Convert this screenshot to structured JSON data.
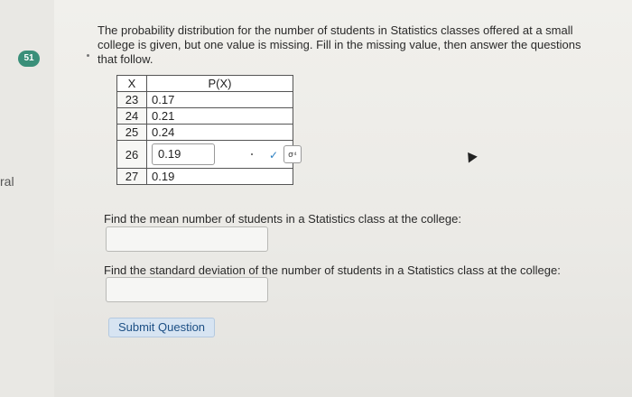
{
  "question_badge": "51",
  "side_text": "ral",
  "prompt": "The probability distribution for the number of students in Statistics classes offered at a small college is given, but one value is missing. Fill in the missing value, then answer the questions that follow.",
  "table": {
    "headers": {
      "x": "X",
      "px": "P(X)"
    },
    "rows": [
      {
        "x": "23",
        "px": "0.17"
      },
      {
        "x": "24",
        "px": "0.21"
      },
      {
        "x": "25",
        "px": "0.24"
      },
      {
        "x": "26",
        "px": "0.19",
        "input": true
      },
      {
        "x": "27",
        "px": "0.19"
      }
    ],
    "checkmark": "✓",
    "sigma_button": "σ⁴"
  },
  "q1": {
    "label": "Find the mean number of students in a Statistics class at the college:",
    "value": ""
  },
  "q2": {
    "label": "Find the standard deviation of the number of students in a Statistics class at the college:",
    "value": ""
  },
  "submit_label": "Submit Question"
}
